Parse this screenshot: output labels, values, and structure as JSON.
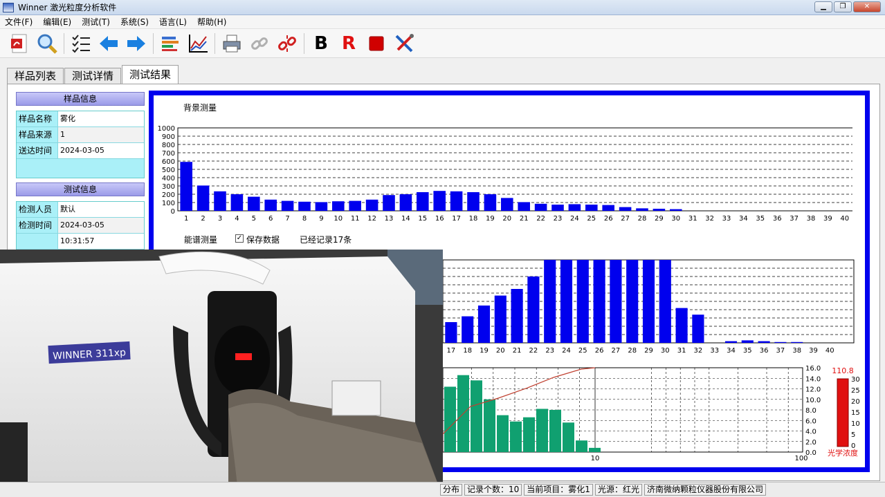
{
  "window": {
    "title": "Winner 激光粒度分析软件",
    "buttons": {
      "minimize": "▁",
      "maximize": "❐",
      "close": "✕"
    }
  },
  "menu": [
    "文件(F)",
    "编辑(E)",
    "测试(T)",
    "系统(S)",
    "语言(L)",
    "帮助(H)"
  ],
  "toolbar": {
    "icons": [
      "pdf-icon",
      "zoom-icon",
      "checklist-icon",
      "arrow-left-icon",
      "arrow-right-icon",
      "bars-icon",
      "line-chart-icon",
      "printer-icon",
      "link-icon",
      "unlink-icon"
    ],
    "letter_b": "B",
    "letter_r": "R",
    "stop_icon": "stop-icon",
    "tools_icon": "tools-icon",
    "colors": {
      "b": "#000000",
      "r": "#e01010",
      "stop": "#d00000"
    }
  },
  "tabs": [
    {
      "label": "样品列表",
      "active": false
    },
    {
      "label": "测试详情",
      "active": false
    },
    {
      "label": "测试结果",
      "active": true
    }
  ],
  "sample_info": {
    "header": "样品信息",
    "rows": [
      {
        "key": "样品名称",
        "value": "雾化"
      },
      {
        "key": "样品来源",
        "value": "1"
      },
      {
        "key": "送达时间",
        "value": "2024-03-05"
      }
    ]
  },
  "test_info": {
    "header": "测试信息",
    "rows": [
      {
        "key": "检测人员",
        "value": "默认"
      },
      {
        "key": "检测时间",
        "value": "2024-03-05"
      },
      {
        "key": "",
        "value": "10:31:57"
      }
    ]
  },
  "spectrum": {
    "label": "能谱测量",
    "save_label": "保存数据",
    "save_checked": true,
    "records": "已经记录17条"
  },
  "chart_data": [
    {
      "type": "bar",
      "title": "背景测量",
      "categories": [
        "1",
        "2",
        "3",
        "4",
        "5",
        "6",
        "7",
        "8",
        "9",
        "10",
        "11",
        "12",
        "13",
        "14",
        "15",
        "16",
        "17",
        "18",
        "19",
        "20",
        "21",
        "22",
        "23",
        "24",
        "25",
        "26",
        "27",
        "28",
        "29",
        "30",
        "31",
        "32",
        "33",
        "34",
        "35",
        "36",
        "37",
        "38",
        "39",
        "40"
      ],
      "values": [
        590,
        305,
        235,
        200,
        170,
        135,
        120,
        110,
        105,
        115,
        120,
        135,
        190,
        200,
        225,
        240,
        235,
        225,
        200,
        155,
        105,
        85,
        75,
        80,
        75,
        70,
        45,
        30,
        25,
        20,
        0,
        0,
        0,
        0,
        0,
        0,
        0,
        0,
        0,
        0
      ],
      "ylim": [
        0,
        1000
      ],
      "yticks": [
        0,
        100,
        200,
        300,
        400,
        500,
        600,
        700,
        800,
        900,
        1000
      ],
      "grid": true,
      "color": "#0000ee"
    },
    {
      "type": "bar",
      "title": "",
      "categories": [
        "17",
        "18",
        "19",
        "20",
        "21",
        "22",
        "23",
        "24",
        "25",
        "26",
        "27",
        "28",
        "29",
        "30",
        "31",
        "32",
        "33",
        "34",
        "35",
        "36",
        "37",
        "38",
        "39",
        "40"
      ],
      "values": [
        25,
        32,
        45,
        57,
        65,
        80,
        100,
        100,
        100,
        100,
        100,
        100,
        100,
        100,
        42,
        34,
        0,
        2,
        3,
        2,
        1,
        1,
        0,
        0
      ],
      "ylim": [
        0,
        100
      ],
      "grid": true,
      "color": "#0000ee"
    },
    {
      "type": "bar",
      "title": "",
      "xscale": "log",
      "x_tick_labels": [
        "10",
        "100"
      ],
      "y_right_ticks": [
        "16.0",
        "14.0",
        "12.0",
        "10.0",
        "8.0",
        "6.0",
        "4.0",
        "2.0",
        "0.0"
      ],
      "ylim": [
        0,
        16
      ],
      "values": [
        12.4,
        14.6,
        13.6,
        10.0,
        7.0,
        5.8,
        6.6,
        8.2,
        8.0,
        5.6,
        2.2,
        0.8
      ],
      "cumulative_line_color": "#c04030",
      "bar_color": "#10a070",
      "concentration": {
        "value": "110.8",
        "label": "光学浓度",
        "ticks": [
          "30",
          "25",
          "20",
          "15",
          "10",
          "5",
          "0"
        ],
        "color": "#e01010"
      }
    }
  ],
  "device_label": "WINNER 311xp",
  "status": {
    "cells": [
      "分布",
      "记录个数：10",
      "当前项目：雾化1",
      "光源：红光",
      "济南微纳颗粒仪器股份有限公司"
    ]
  }
}
